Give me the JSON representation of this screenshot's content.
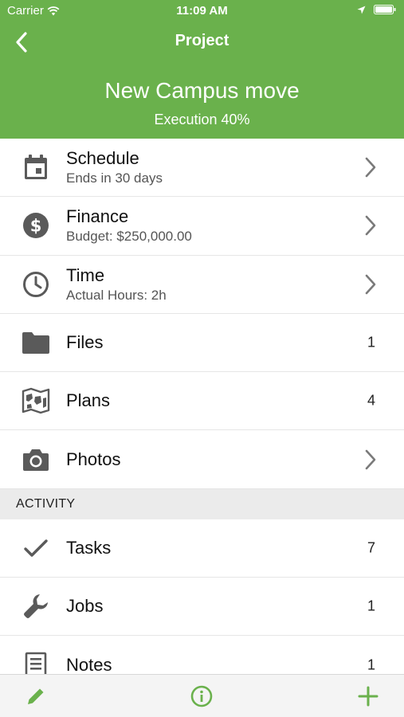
{
  "status_bar": {
    "carrier": "Carrier",
    "time": "11:09 AM"
  },
  "nav": {
    "title": "Project"
  },
  "project": {
    "name": "New Campus move",
    "status": "Execution 40%"
  },
  "rows": [
    {
      "label": "Schedule",
      "subtitle": "Ends in 30 days",
      "icon": "calendar-icon"
    },
    {
      "label": "Finance",
      "subtitle": "Budget: $250,000.00",
      "icon": "dollar-icon"
    },
    {
      "label": "Time",
      "subtitle": "Actual Hours: 2h",
      "icon": "clock-icon"
    },
    {
      "label": "Files",
      "count": "1",
      "icon": "folder-icon"
    },
    {
      "label": "Plans",
      "count": "4",
      "icon": "map-icon"
    },
    {
      "label": "Photos",
      "icon": "camera-icon"
    }
  ],
  "activity": {
    "header": "ACTIVITY",
    "rows": [
      {
        "label": "Tasks",
        "count": "7",
        "icon": "checkmark-icon"
      },
      {
        "label": "Jobs",
        "count": "1",
        "icon": "wrench-icon"
      },
      {
        "label": "Notes",
        "count": "1",
        "icon": "notes-icon"
      }
    ]
  },
  "colors": {
    "brand": "#6ab14c",
    "icon": "#5a5a5a",
    "section_bg": "#ebebeb"
  }
}
